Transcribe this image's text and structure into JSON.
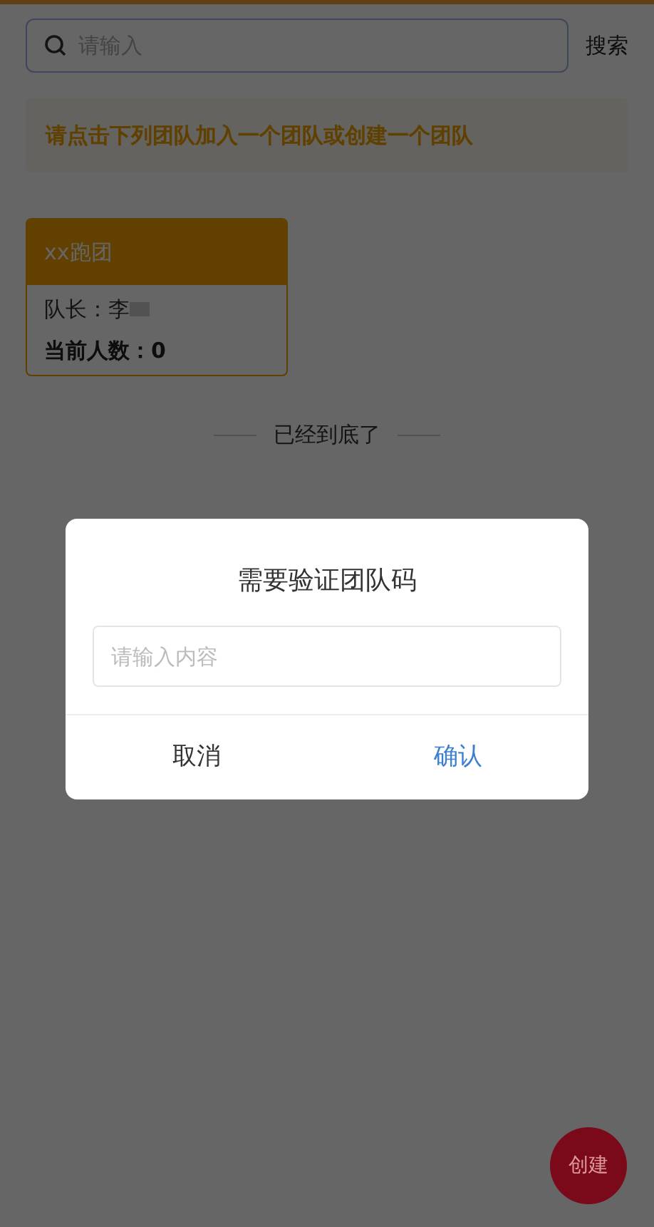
{
  "search": {
    "placeholder": "请输入",
    "button": "搜索"
  },
  "notice": "请点击下列团队加入一个团队或创建一个团队",
  "teams": [
    {
      "name": "xx跑团",
      "leader": "队长：李",
      "members": "当前人数：0"
    }
  ],
  "end_text": "已经到底了",
  "dialog": {
    "title": "需要验证团队码",
    "input_placeholder": "请输入内容",
    "cancel": "取消",
    "confirm": "确认"
  },
  "fab": "创建"
}
